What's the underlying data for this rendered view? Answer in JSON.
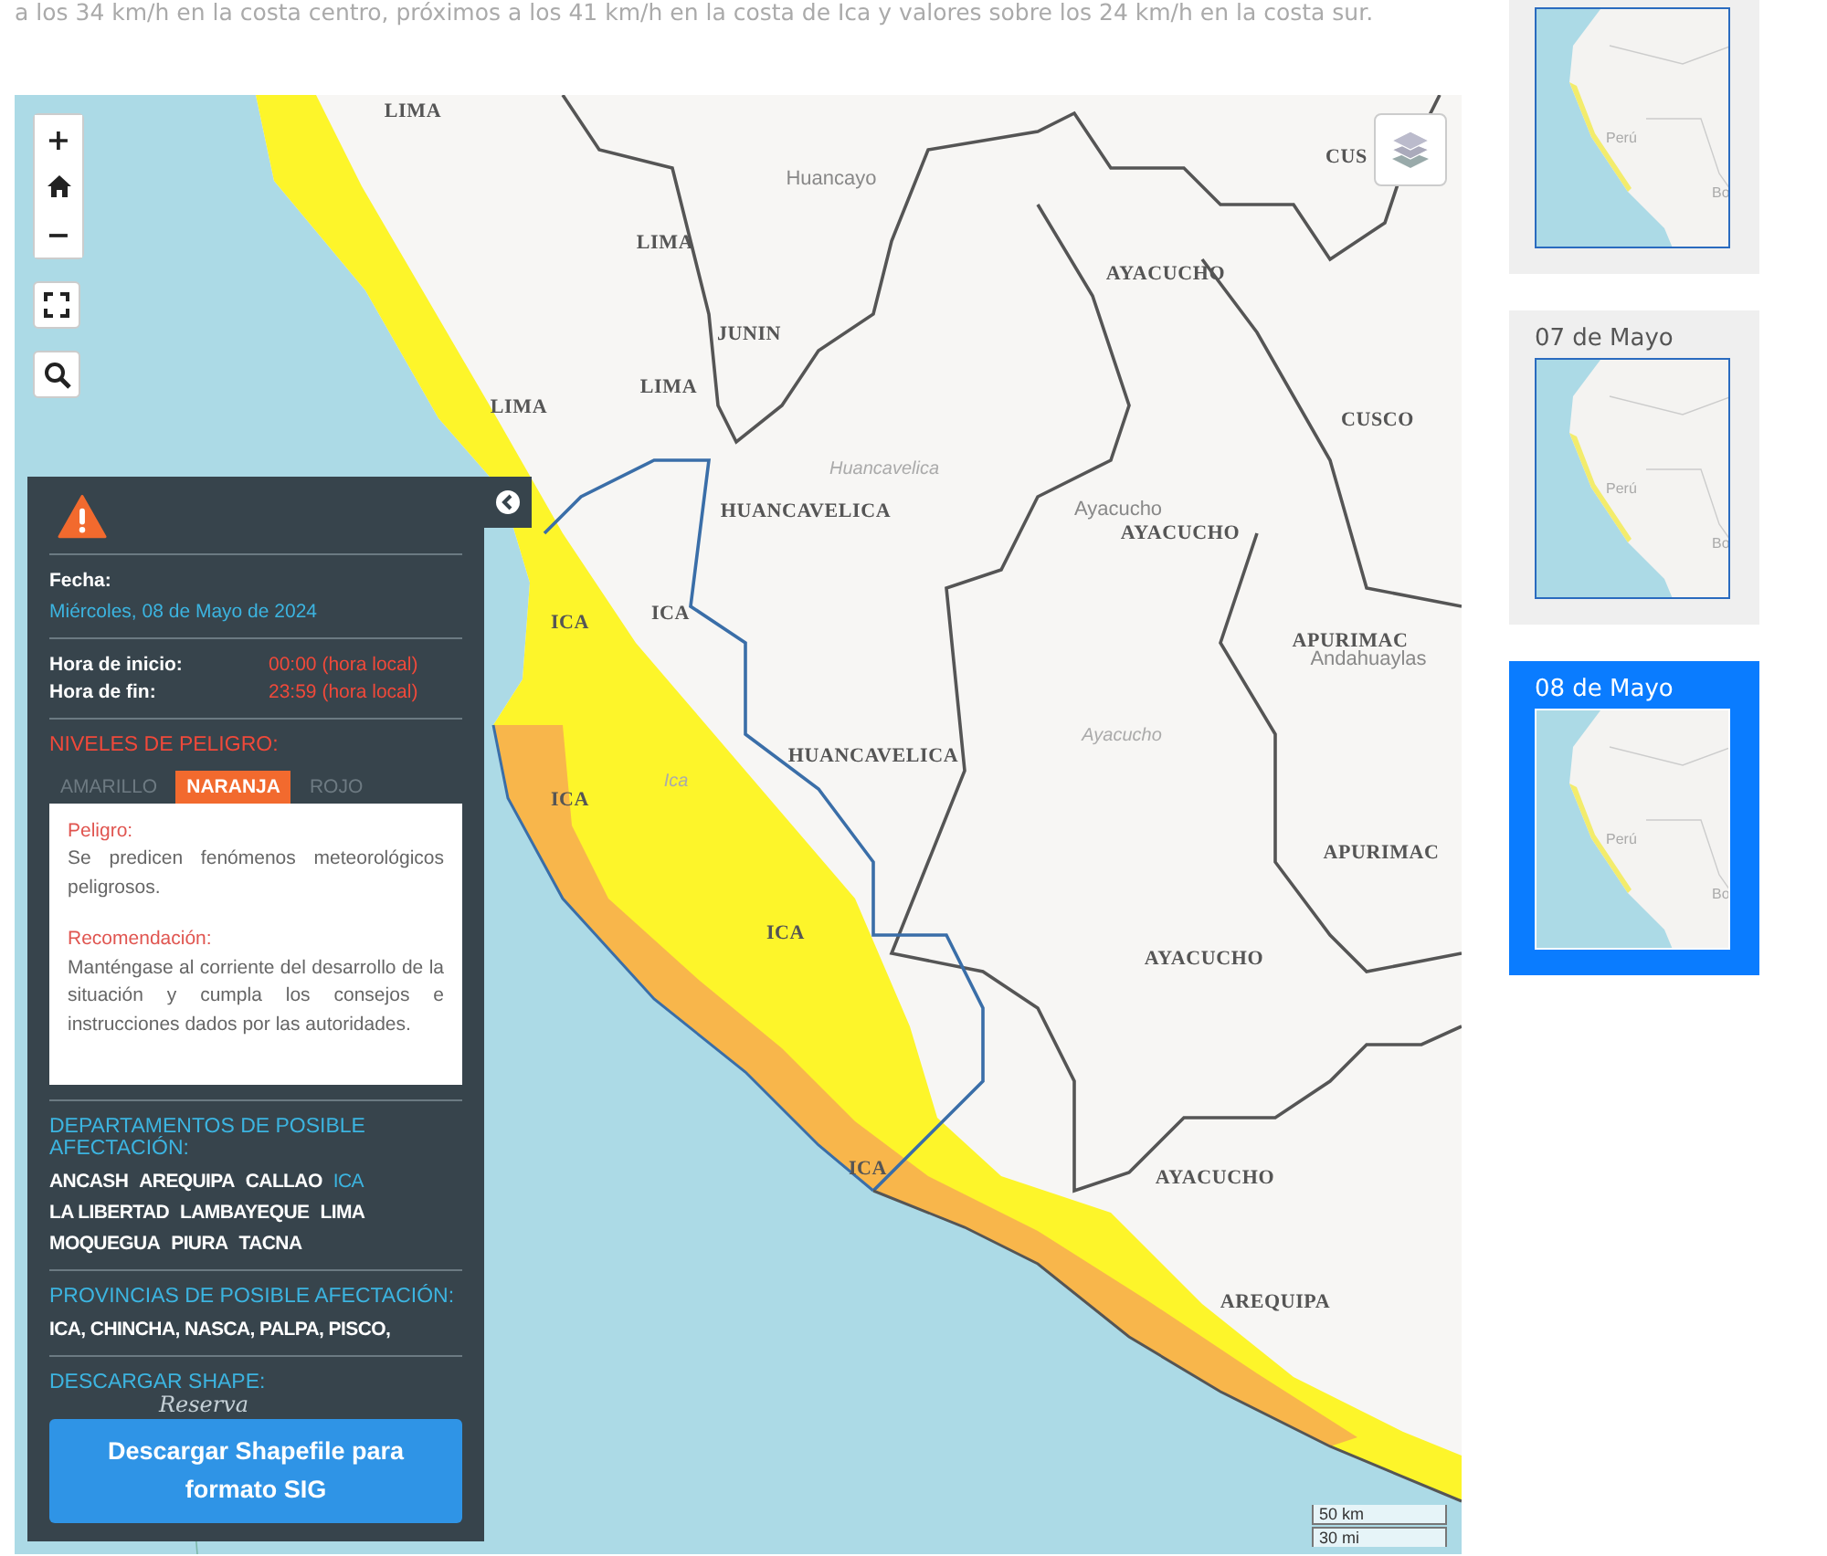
{
  "intro_text": "a los 34 km/h en la costa centro, próximos a los 41 km/h en la costa de Ica y valores sobre los 24 km/h en la costa sur.",
  "map": {
    "labels": [
      {
        "text": "LIMA",
        "kind": "department"
      },
      {
        "text": "LIMA",
        "kind": "department"
      },
      {
        "text": "LIMA",
        "kind": "department"
      },
      {
        "text": "LIMA",
        "kind": "department"
      },
      {
        "text": "JUNIN",
        "kind": "department"
      },
      {
        "text": "AYACUCHO",
        "kind": "department"
      },
      {
        "text": "CUS",
        "kind": "department"
      },
      {
        "text": "CUSCO",
        "kind": "department"
      },
      {
        "text": "HUANCAVELICA",
        "kind": "department"
      },
      {
        "text": "AYACUCHO",
        "kind": "department"
      },
      {
        "text": "APURIMAC",
        "kind": "department"
      },
      {
        "text": "ICA",
        "kind": "department"
      },
      {
        "text": "ICA",
        "kind": "department"
      },
      {
        "text": "ICA",
        "kind": "department"
      },
      {
        "text": "HUANCAVELICA",
        "kind": "department"
      },
      {
        "text": "APURIMAC",
        "kind": "department"
      },
      {
        "text": "ICA",
        "kind": "department"
      },
      {
        "text": "AYACUCHO",
        "kind": "department"
      },
      {
        "text": "ICA",
        "kind": "department"
      },
      {
        "text": "AYACUCHO",
        "kind": "department"
      },
      {
        "text": "AREQUIPA",
        "kind": "department"
      },
      {
        "text": "Huancayo",
        "kind": "city"
      },
      {
        "text": "Huancavelica",
        "kind": "region"
      },
      {
        "text": "Ayacucho",
        "kind": "city"
      },
      {
        "text": "Andahuaylas",
        "kind": "city"
      },
      {
        "text": "Ayacucho",
        "kind": "region"
      },
      {
        "text": "Ica",
        "kind": "region"
      },
      {
        "text": "Reserva",
        "kind": "reserve"
      }
    ],
    "zoom_in": "+",
    "zoom_out": "−",
    "scale_metric": "50 km",
    "scale_imperial": "30 mi"
  },
  "alert_panel": {
    "date_label": "Fecha:",
    "date": "Miércoles, 08 de Mayo de 2024",
    "start_label": "Hora de inicio:",
    "start_time": "00:00 (hora local)",
    "end_label": "Hora de fin:",
    "end_time": "23:59 (hora local)",
    "levels_title": "NIVELES DE PELIGRO:",
    "levels": [
      {
        "label": "AMARILLO",
        "selected": false
      },
      {
        "label": "NARANJA",
        "selected": true
      },
      {
        "label": "ROJO",
        "selected": false
      }
    ],
    "danger_label": "Peligro:",
    "danger_text": "Se predicen fenómenos meteorológicos peligrosos.",
    "recommendation_label": "Recomendación:",
    "recommendation_text": "Manténgase al corriente del desarrollo de la situación y cumpla los consejos e instrucciones dados por las autoridades.",
    "departments_title": "DEPARTAMENTOS DE POSIBLE AFECTACIÓN:",
    "departments": [
      {
        "name": "ANCASH",
        "highlighted": false
      },
      {
        "name": "AREQUIPA",
        "highlighted": false
      },
      {
        "name": "CALLAO",
        "highlighted": false
      },
      {
        "name": "ICA",
        "highlighted": true
      },
      {
        "name": "LA LIBERTAD",
        "highlighted": false
      },
      {
        "name": "LAMBAYEQUE",
        "highlighted": false
      },
      {
        "name": "LIMA",
        "highlighted": false
      },
      {
        "name": "MOQUEGUA",
        "highlighted": false
      },
      {
        "name": "PIURA",
        "highlighted": false
      },
      {
        "name": "TACNA",
        "highlighted": false
      }
    ],
    "provinces_title": "PROVINCIAS DE POSIBLE AFECTACIÓN:",
    "provinces": "ICA, CHINCHA, NASCA, PALPA, PISCO,",
    "download_title": "DESCARGAR SHAPE:",
    "download_button": "Descargar Shapefile para formato SIG"
  },
  "forecast_days": [
    {
      "selected": false,
      "country_label": "Perú",
      "neighbor_label": "Bo"
    },
    {
      "label": "07 de Mayo",
      "selected": false,
      "country_label": "Perú",
      "neighbor_label": "Bo"
    },
    {
      "label": "08 de Mayo",
      "selected": true,
      "country_label": "Perú",
      "neighbor_label": "Bo"
    }
  ]
}
